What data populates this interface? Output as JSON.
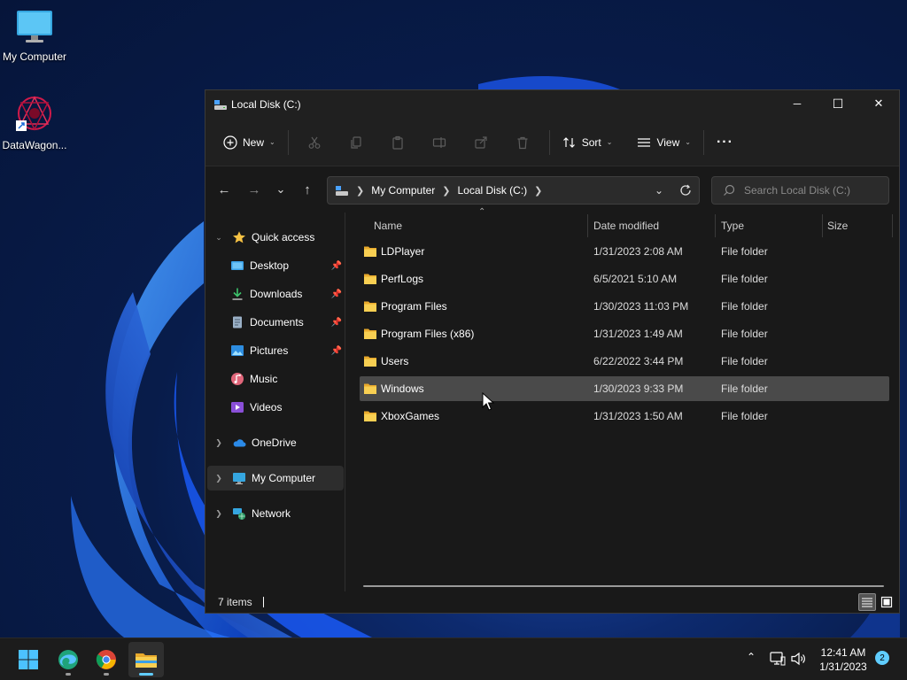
{
  "desktop": {
    "icons": [
      {
        "label": "My Computer"
      },
      {
        "label": "DataWagon..."
      }
    ]
  },
  "window": {
    "title": "Local Disk (C:)",
    "controls": {
      "minimize": "─",
      "maximize": "☐",
      "close": "✕"
    }
  },
  "toolbar": {
    "new_label": "New",
    "sort_label": "Sort",
    "view_label": "View",
    "more_label": "···"
  },
  "navigation": {
    "back": "←",
    "forward": "→",
    "recent": "⌄",
    "up": "↑"
  },
  "address": {
    "crumbs": [
      "My Computer",
      "Local Disk (C:)"
    ]
  },
  "search": {
    "placeholder": "Search Local Disk (C:)"
  },
  "sidebar": {
    "quick_access": "Quick access",
    "items": [
      {
        "label": "Desktop",
        "pinned": true
      },
      {
        "label": "Downloads",
        "pinned": true
      },
      {
        "label": "Documents",
        "pinned": true
      },
      {
        "label": "Pictures",
        "pinned": true
      },
      {
        "label": "Music",
        "pinned": false
      },
      {
        "label": "Videos",
        "pinned": false
      }
    ],
    "onedrive": "OneDrive",
    "my_computer": "My Computer",
    "network": "Network"
  },
  "columns": {
    "name": "Name",
    "date": "Date modified",
    "type": "Type",
    "size": "Size"
  },
  "files": [
    {
      "name": "LDPlayer",
      "date": "1/31/2023 2:08 AM",
      "type": "File folder"
    },
    {
      "name": "PerfLogs",
      "date": "6/5/2021 5:10 AM",
      "type": "File folder"
    },
    {
      "name": "Program Files",
      "date": "1/30/2023 11:03 PM",
      "type": "File folder"
    },
    {
      "name": "Program Files (x86)",
      "date": "1/31/2023 1:49 AM",
      "type": "File folder"
    },
    {
      "name": "Users",
      "date": "6/22/2022 3:44 PM",
      "type": "File folder"
    },
    {
      "name": "Windows",
      "date": "1/30/2023 9:33 PM",
      "type": "File folder"
    },
    {
      "name": "XboxGames",
      "date": "1/31/2023 1:50 AM",
      "type": "File folder"
    }
  ],
  "status": {
    "count": "7 items"
  },
  "taskbar": {
    "time": "12:41 AM",
    "date": "1/31/2023",
    "notifications": "2"
  },
  "colors": {
    "accent": "#60cdff",
    "folder": "#f6c244"
  }
}
